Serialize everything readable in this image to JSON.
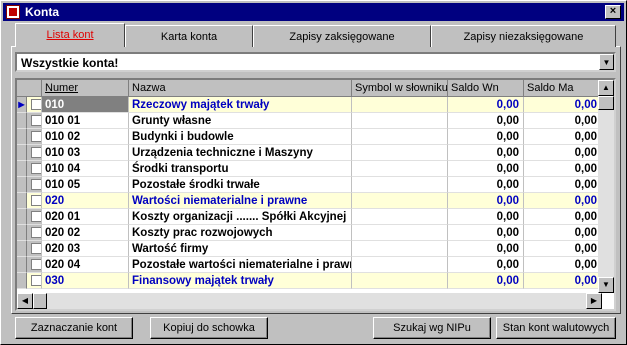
{
  "window": {
    "title": "Konta",
    "close_label": "×"
  },
  "tabs": [
    {
      "label": "Lista kont",
      "active": true
    },
    {
      "label": "Karta konta",
      "active": false
    },
    {
      "label": "Zapisy zaksięgowane",
      "active": false
    },
    {
      "label": "Zapisy niezaksięgowane",
      "active": false
    }
  ],
  "filter": {
    "value": "Wszystkie konta!",
    "arrow_icon": "chevron-down-icon"
  },
  "grid": {
    "columns": [
      "Numer",
      "Nazwa",
      "Symbol w słowniku",
      "Saldo Wn",
      "Saldo Ma"
    ],
    "rows": [
      {
        "num": "010",
        "name": "Rzeczowy majątek trwały",
        "sym": "",
        "wn": "0,00",
        "ma": "0,00",
        "group": true,
        "current": true
      },
      {
        "num": "010 01",
        "name": "Grunty własne",
        "sym": "",
        "wn": "0,00",
        "ma": "0,00",
        "group": false
      },
      {
        "num": "010 02",
        "name": "Budynki i budowle",
        "sym": "",
        "wn": "0,00",
        "ma": "0,00",
        "group": false
      },
      {
        "num": "010 03",
        "name": "Urządzenia techniczne i Maszyny",
        "sym": "",
        "wn": "0,00",
        "ma": "0,00",
        "group": false
      },
      {
        "num": "010 04",
        "name": "Środki transportu",
        "sym": "",
        "wn": "0,00",
        "ma": "0,00",
        "group": false
      },
      {
        "num": "010 05",
        "name": "Pozostałe środki trwałe",
        "sym": "",
        "wn": "0,00",
        "ma": "0,00",
        "group": false
      },
      {
        "num": "020",
        "name": "Wartości niematerialne i prawne",
        "sym": "",
        "wn": "0,00",
        "ma": "0,00",
        "group": true
      },
      {
        "num": "020 01",
        "name": "Koszty organizacji ....... Spółki Akcyjnej",
        "sym": "",
        "wn": "0,00",
        "ma": "0,00",
        "group": false
      },
      {
        "num": "020 02",
        "name": "Koszty prac rozwojowych",
        "sym": "",
        "wn": "0,00",
        "ma": "0,00",
        "group": false
      },
      {
        "num": "020 03",
        "name": "Wartość firmy",
        "sym": "",
        "wn": "0,00",
        "ma": "0,00",
        "group": false
      },
      {
        "num": "020 04",
        "name": "Pozostałe wartości niematerialne i prawne",
        "sym": "",
        "wn": "0,00",
        "ma": "0,00",
        "group": false
      },
      {
        "num": "030",
        "name": "Finansowy majątek trwały",
        "sym": "",
        "wn": "0,00",
        "ma": "0,00",
        "group": true
      }
    ]
  },
  "buttons": {
    "mark": "Zaznaczanie kont",
    "copy": "Kopiuj do schowka",
    "nip": "Szukaj wg NIPu",
    "currency": "Stan kont walutowych"
  }
}
